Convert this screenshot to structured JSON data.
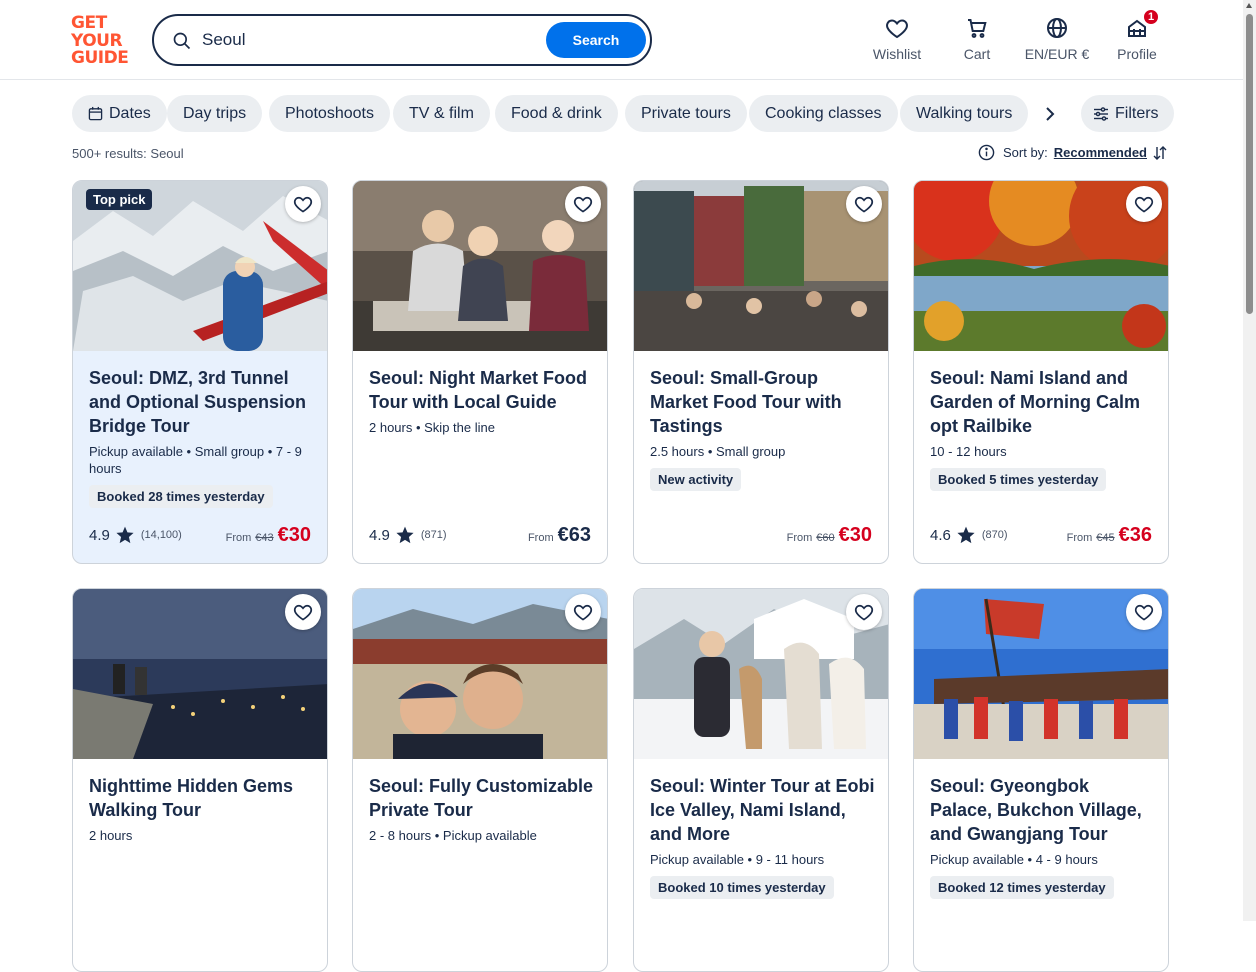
{
  "logo": {
    "line1": "GET",
    "line2": "YOUR",
    "line3": "GUIDE"
  },
  "search": {
    "value": "Seoul",
    "button": "Search"
  },
  "nav": [
    {
      "label": "Wishlist",
      "icon": "heart-outline-icon"
    },
    {
      "label": "Cart",
      "icon": "cart-icon"
    },
    {
      "label": "EN/EUR €",
      "icon": "globe-icon"
    },
    {
      "label": "Profile",
      "icon": "profile-icon",
      "badge": "1"
    }
  ],
  "chips": [
    {
      "label": "Dates",
      "icon": "calendar-icon"
    },
    {
      "label": "Day trips"
    },
    {
      "label": "Photoshoots"
    },
    {
      "label": "TV & film"
    },
    {
      "label": "Food & drink"
    },
    {
      "label": "Private tours"
    },
    {
      "label": "Cooking classes"
    },
    {
      "label": "Walking tours"
    }
  ],
  "filters": "Filters",
  "results": "500+ results: Seoul",
  "sort": {
    "label": "Sort by:",
    "value": "Recommended"
  },
  "colors": {
    "accent": "#0071eb",
    "brand": "#ff5533",
    "sale": "#d5001e",
    "text": "#1a2b49"
  },
  "cards": [
    {
      "toppick": "Top pick",
      "title": "Seoul: DMZ, 3rd Tunnel and Optional Suspension Bridge Tour",
      "meta": "Pickup available • Small group • 7 - 9 hours",
      "pill": "Booked 28 times yesterday",
      "rating": "4.9",
      "count": "(14,100)",
      "from": "From",
      "old": "€43",
      "price": "€30"
    },
    {
      "title": "Seoul: Night Market Food Tour with Local Guide",
      "meta": "2 hours • Skip the line",
      "rating": "4.9",
      "count": "(871)",
      "from": "From",
      "price": "€63"
    },
    {
      "title": "Seoul: Small-Group Market Food Tour with Tastings",
      "meta": "2.5 hours • Small group",
      "pill": "New activity",
      "from": "From",
      "old": "€60",
      "price": "€30"
    },
    {
      "title": "Seoul: Nami Island and Garden of Morning Calm opt Railbike",
      "meta": "10 - 12 hours",
      "pill": "Booked 5 times yesterday",
      "rating": "4.6",
      "count": "(870)",
      "from": "From",
      "old": "€45",
      "price": "€36"
    },
    {
      "title": "Nighttime Hidden Gems Walking Tour",
      "meta": "2 hours"
    },
    {
      "title": "Seoul: Fully Customizable Private Tour",
      "meta": "2 - 8 hours • Pickup available"
    },
    {
      "title": "Seoul: Winter Tour at Eobi Ice Valley, Nami Island, and More",
      "meta": "Pickup available • 9 - 11 hours",
      "pill": "Booked 10 times yesterday"
    },
    {
      "title": "Seoul: Gyeongbok Palace, Bukchon Village, and Gwangjang Tour",
      "meta": "Pickup available • 4 - 9 hours",
      "pill": "Booked 12 times yesterday"
    }
  ]
}
